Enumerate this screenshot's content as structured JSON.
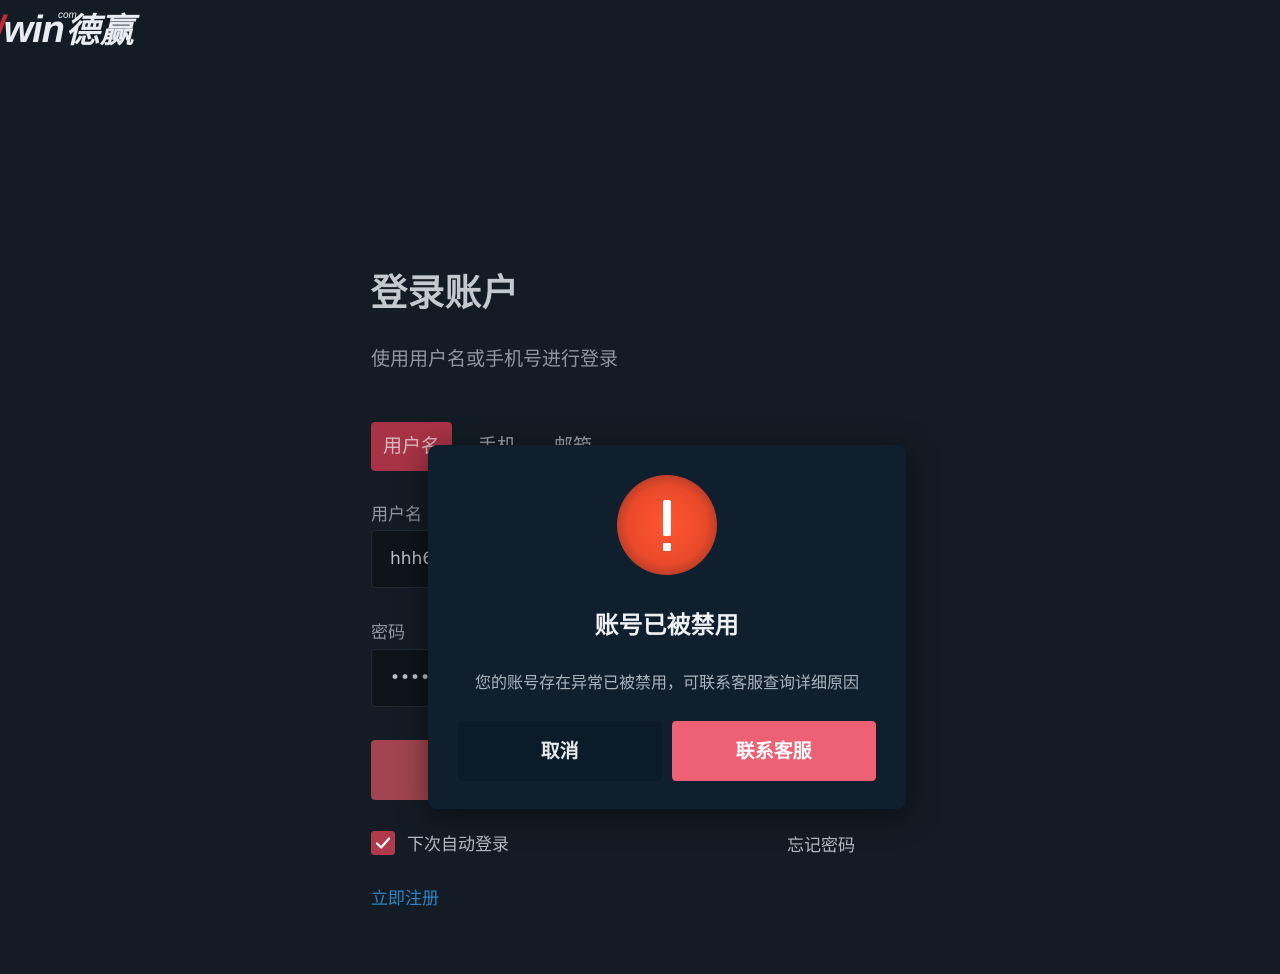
{
  "logo": {
    "slash": "/",
    "word": "win",
    "com": "com",
    "chinese": "德赢"
  },
  "login": {
    "title": "登录账户",
    "subtitle": "使用用户名或手机号进行登录",
    "tabs": [
      {
        "label": "用户名",
        "active": true
      },
      {
        "label": "手机",
        "active": false
      },
      {
        "label": "邮箱",
        "active": false
      }
    ],
    "username_label": "用户名",
    "username_value": "hhh6",
    "password_label": "密码",
    "password_value": "•••••••",
    "remember_label": "下次自动登录",
    "remember_checked": true,
    "forgot_label": "忘记密码",
    "register_label": "立即注册"
  },
  "dialog": {
    "icon": "warning-icon",
    "title": "账号已被禁用",
    "message": "您的账号存在异常已被禁用，可联系客服查询详细原因",
    "cancel_label": "取消",
    "contact_label": "联系客服"
  },
  "colors": {
    "background": "#131c24",
    "accent": "#ee6175",
    "tab_active": "#a83345",
    "link": "#2b83c6",
    "dialog_bg": "#0f1f2e",
    "warning": "#ea4a2a"
  }
}
